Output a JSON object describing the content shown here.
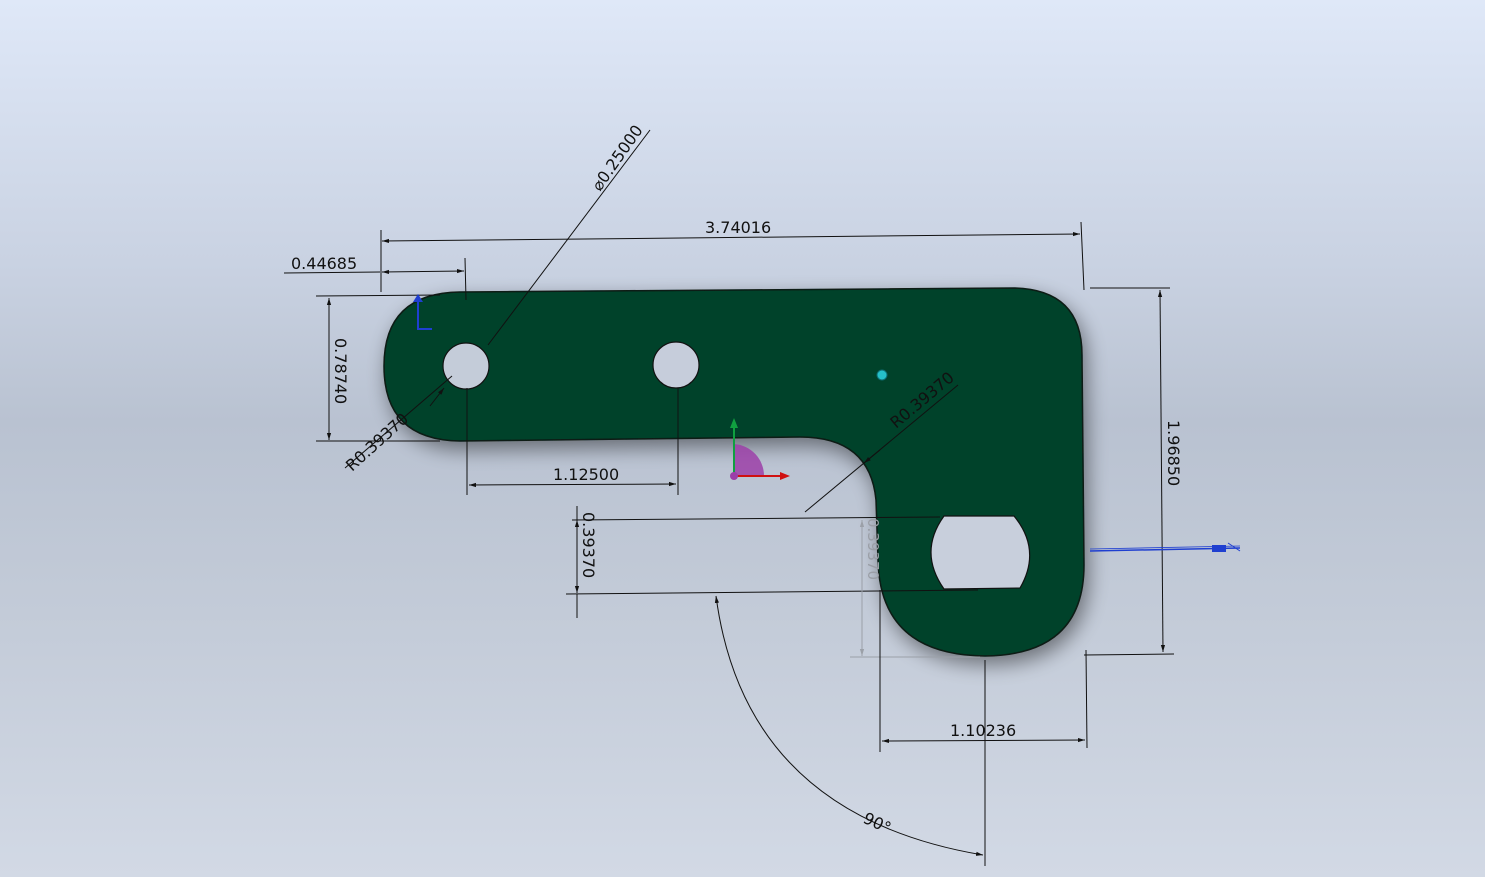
{
  "graphics_area": {
    "background_top": "#dfe8f8",
    "background_mid": "#b9c2d1",
    "part_color": "#00422a",
    "dimensions": {
      "overall_width": "3.74016",
      "left_offset": "0.44685",
      "hole_diameter": "⌀0.25000",
      "height_left": "0.78740",
      "radius_left": "R0.39370",
      "hole_spacing": "1.12500",
      "radius_inner": "R0.39370",
      "height_right": "1.96850",
      "slot_height": "0.39370",
      "slot_height_hidden": "0.39370",
      "bottom_width": "1.10236",
      "angle": "90°"
    }
  },
  "triad": {
    "x_color": "#d01010",
    "y_color": "#10a040",
    "z_color": "#9c3fa8"
  },
  "icons": {
    "origin": "origin-icon",
    "triad": "reference-triad-icon",
    "center_of_mass": "center-of-mass-icon",
    "plane_marker": "plane-marker-icon"
  }
}
